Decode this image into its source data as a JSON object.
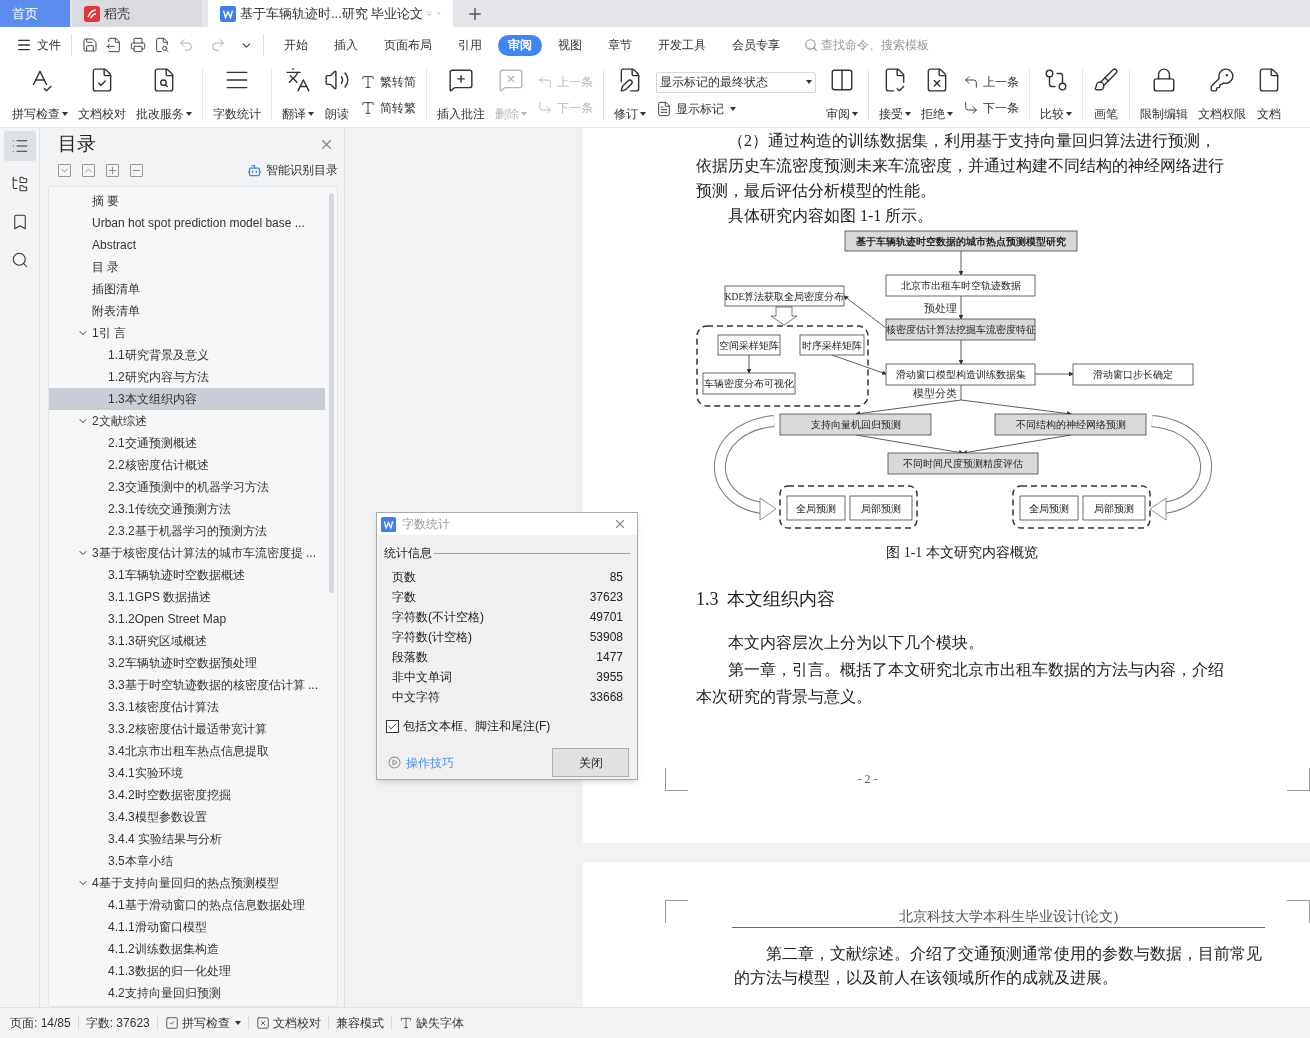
{
  "tabs": [
    {
      "label": "首页",
      "kind": "home",
      "selected": false
    },
    {
      "label": "稻壳",
      "kind": "docer",
      "selected": false
    },
    {
      "label": "基于车辆轨迹时...研究 毕业论文",
      "kind": "doc",
      "selected": true
    }
  ],
  "menu": {
    "file": "文件",
    "items": [
      {
        "label": "开始",
        "selected": false
      },
      {
        "label": "插入",
        "selected": false
      },
      {
        "label": "页面布局",
        "selected": false
      },
      {
        "label": "引用",
        "selected": false
      },
      {
        "label": "审阅",
        "selected": true
      },
      {
        "label": "视图",
        "selected": false
      },
      {
        "label": "章节",
        "selected": false
      },
      {
        "label": "开发工具",
        "selected": false
      },
      {
        "label": "会员专享",
        "selected": false
      }
    ],
    "search_placeholder": "查找命令、搜索模板"
  },
  "ribbon": [
    {
      "kind": "big",
      "label": "拼写检查",
      "dropdown": true,
      "disabled": false
    },
    {
      "kind": "big",
      "label": "文档校对",
      "dropdown": false,
      "disabled": false
    },
    {
      "kind": "big",
      "label": "批改服务",
      "dropdown": true,
      "disabled": false
    },
    {
      "kind": "separator"
    },
    {
      "kind": "big",
      "label": "字数统计",
      "dropdown": false,
      "disabled": false
    },
    {
      "kind": "separator"
    },
    {
      "kind": "big",
      "label": "翻译",
      "dropdown": true,
      "disabled": false
    },
    {
      "kind": "big",
      "label": "朗读",
      "dropdown": false,
      "disabled": false
    },
    {
      "kind": "pair",
      "rows": [
        {
          "label": "繁转简",
          "disabled": false
        },
        {
          "label": "简转繁",
          "disabled": false
        }
      ]
    },
    {
      "kind": "separator"
    },
    {
      "kind": "big",
      "label": "插入批注",
      "dropdown": false,
      "disabled": false
    },
    {
      "kind": "big",
      "label": "删除",
      "dropdown": true,
      "disabled": true
    },
    {
      "kind": "pair",
      "rows": [
        {
          "label": "上一条",
          "disabled": true
        },
        {
          "label": "下一条",
          "disabled": true
        }
      ]
    },
    {
      "kind": "separator"
    },
    {
      "kind": "big",
      "label": "修订",
      "dropdown": true,
      "disabled": false
    },
    {
      "kind": "select",
      "value": "显示标记的最终状态",
      "below": "显示标记"
    },
    {
      "kind": "big",
      "label": "审阅",
      "dropdown": true,
      "disabled": false
    },
    {
      "kind": "separator"
    },
    {
      "kind": "big",
      "label": "接受",
      "dropdown": true,
      "disabled": false
    },
    {
      "kind": "big",
      "label": "拒绝",
      "dropdown": true,
      "disabled": false
    },
    {
      "kind": "pair",
      "rows": [
        {
          "label": "上一条",
          "disabled": false
        },
        {
          "label": "下一条",
          "disabled": false
        }
      ]
    },
    {
      "kind": "separator"
    },
    {
      "kind": "big",
      "label": "比较",
      "dropdown": true,
      "disabled": false
    },
    {
      "kind": "separator"
    },
    {
      "kind": "big",
      "label": "画笔",
      "dropdown": false,
      "disabled": false
    },
    {
      "kind": "separator"
    },
    {
      "kind": "big",
      "label": "限制编辑",
      "dropdown": false,
      "disabled": false
    },
    {
      "kind": "big",
      "label": "文档权限",
      "dropdown": false,
      "disabled": false
    },
    {
      "kind": "big",
      "label": "文档",
      "dropdown": false,
      "disabled": false
    }
  ],
  "side_nav": [
    {
      "selected": true
    },
    {
      "selected": false
    },
    {
      "selected": false
    },
    {
      "selected": false
    }
  ],
  "toc": {
    "title": "目录",
    "smart_button": "智能识别目录",
    "items": [
      {
        "label": "摘 要",
        "selected": false
      },
      {
        "label": "Urban hot spot prediction model base ...",
        "selected": false
      },
      {
        "label": "Abstract",
        "selected": false
      },
      {
        "label": "目 录",
        "selected": false
      },
      {
        "label": "插图清单",
        "selected": false
      },
      {
        "label": "附表清单",
        "selected": false
      },
      {
        "label": "1引 言",
        "selected": false,
        "expanded": true,
        "children": [
          {
            "label": "1.1研究背景及意义",
            "selected": false
          },
          {
            "label": "1.2研究内容与方法",
            "selected": false
          },
          {
            "label": "1.3本文组织内容",
            "selected": true
          }
        ]
      },
      {
        "label": "2文献综述",
        "selected": false,
        "expanded": true,
        "children": [
          {
            "label": "2.1交通预测概述",
            "selected": false
          },
          {
            "label": "2.2核密度估计概述",
            "selected": false
          },
          {
            "label": "2.3交通预测中的机器学习方法",
            "selected": false
          },
          {
            "label": "2.3.1传统交通预测方法",
            "selected": false
          },
          {
            "label": "2.3.2基于机器学习的预测方法",
            "selected": false
          }
        ]
      },
      {
        "label": "3基于核密度估计算法的城市车流密度提 ...",
        "selected": false,
        "expanded": true,
        "children": [
          {
            "label": "3.1车辆轨迹时空数据概述",
            "selected": false
          },
          {
            "label": "3.1.1GPS 数据描述",
            "selected": false
          },
          {
            "label": "3.1.2Open Street Map",
            "selected": false
          },
          {
            "label": "3.1.3研究区域概述",
            "selected": false
          },
          {
            "label": "3.2车辆轨迹时空数据预处理",
            "selected": false
          },
          {
            "label": "3.3基于时空轨迹数据的核密度估计算 ...",
            "selected": false
          },
          {
            "label": "3.3.1核密度估计算法",
            "selected": false
          },
          {
            "label": "3.3.2核密度估计最适带宽计算",
            "selected": false
          },
          {
            "label": "3.4北京市出租车热点信息提取",
            "selected": false
          },
          {
            "label": "3.4.1实验环境",
            "selected": false
          },
          {
            "label": "3.4.2时空数据密度挖掘",
            "selected": false
          },
          {
            "label": "3.4.3模型参数设置",
            "selected": false
          },
          {
            "label": "3.4.4 实验结果与分析",
            "selected": false
          },
          {
            "label": "3.5本章小结",
            "selected": false
          }
        ]
      },
      {
        "label": "4基于支持向量回归的热点预测模型",
        "selected": false,
        "expanded": true,
        "children": [
          {
            "label": "4.1基于滑动窗口的热点信息数据处理",
            "selected": false
          },
          {
            "label": "4.1.1滑动窗口模型",
            "selected": false
          },
          {
            "label": "4.1.2训练数据集构造",
            "selected": false
          },
          {
            "label": "4.1.3数据的归一化处理",
            "selected": false
          },
          {
            "label": "4.2支持向量回归预测",
            "selected": false
          }
        ]
      }
    ]
  },
  "dialog": {
    "title": "字数统计",
    "group": "统计信息",
    "rows": [
      {
        "label": "页数",
        "value": "85"
      },
      {
        "label": "字数",
        "value": "37623"
      },
      {
        "label": "字符数(不计空格)",
        "value": "49701"
      },
      {
        "label": "字符数(计空格)",
        "value": "53908"
      },
      {
        "label": "段落数",
        "value": "1477"
      },
      {
        "label": "非中文单词",
        "value": "3955"
      },
      {
        "label": "中文字符",
        "value": "33668"
      }
    ],
    "checkbox": {
      "label": "包括文本框、脚注和尾注(F)",
      "checked": true
    },
    "link": "操作技巧",
    "button": "关闭"
  },
  "page1": {
    "paragraphs": [
      "（2）通过构造的训练数据集，利用基于支持向量回归算法进行预测，依据历史车流密度预测未来车流密度，并通过构建不同结构的神经网络进行预测，最后评估分析模型的性能。",
      "具体研究内容如图 1-1 所示。"
    ],
    "figure": {
      "nodes": [
        {
          "label": "基于车辆轨迹时空数据的城市热点预测模型研究",
          "shaded": true
        },
        {
          "label": "北京市出租车时空轨迹数据",
          "shaded": false
        },
        {
          "label": "KDE算法获取全局密度分布",
          "shaded": false
        },
        {
          "label": "核密度估计算法挖掘车流密度特征",
          "shaded": true
        },
        {
          "label": "空间采样矩阵",
          "shaded": false
        },
        {
          "label": "时序采样矩阵",
          "shaded": false
        },
        {
          "label": "车辆密度分布可视化",
          "shaded": false
        },
        {
          "label": "滑动窗口模型构造训练数据集",
          "shaded": false
        },
        {
          "label": "滑动窗口步长确定",
          "shaded": false
        },
        {
          "label": "支持向量机回归预测",
          "shaded": true
        },
        {
          "label": "不同结构的神经网络预测",
          "shaded": true
        },
        {
          "label": "不同时间尺度预测精度评估",
          "shaded": true
        },
        {
          "label": "全局预测",
          "shaded": false
        },
        {
          "label": "局部预测",
          "shaded": false
        },
        {
          "label": "全局预测",
          "shaded": false
        },
        {
          "label": "局部预测",
          "shaded": false
        }
      ],
      "edge_labels": [
        "预处理",
        "模型分类"
      ],
      "caption": "图 1-1 本文研究内容概览"
    },
    "heading": {
      "number": "1.3",
      "title": "本文组织内容"
    },
    "body": [
      "本文内容层次上分为以下几个模块。",
      "第一章，引言。概括了本文研究北京市出租车数据的方法与内容，介绍本次研究的背景与意义。"
    ],
    "page_number": "- 2 -"
  },
  "page2": {
    "header": "北京科技大学本科生毕业设计(论文)",
    "paragraph": "第二章，文献综述。介绍了交通预测通常使用的参数与数据，目前常见的方法与模型，以及前人在该领域所作的成就及进展。"
  },
  "status": [
    {
      "label": "页面: 14/85",
      "kind": "text",
      "dropdown": false
    },
    {
      "label": "字数: 37623",
      "kind": "text",
      "dropdown": false
    },
    {
      "label": "拼写检查",
      "kind": "check",
      "dropdown": true
    },
    {
      "label": "文档校对",
      "kind": "xbox",
      "dropdown": false
    },
    {
      "label": "兼容模式",
      "kind": "text",
      "dropdown": false
    },
    {
      "label": "缺失字体",
      "kind": "font",
      "dropdown": false
    }
  ]
}
